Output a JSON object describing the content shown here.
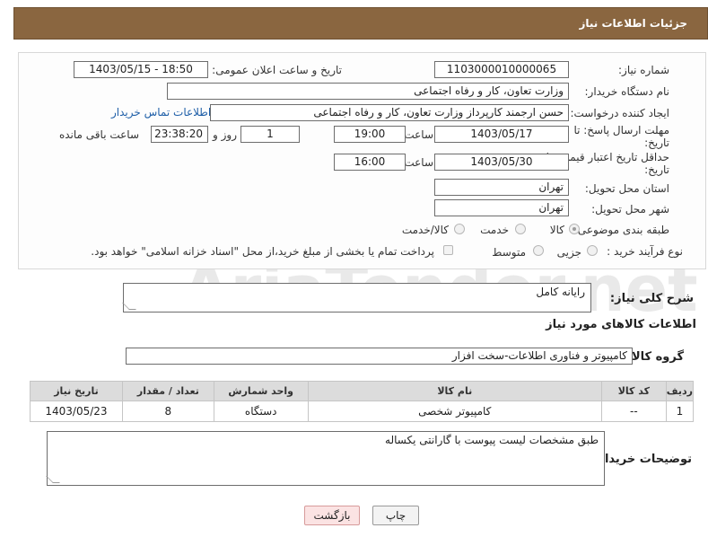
{
  "header": {
    "title": "جزئیات اطلاعات نیاز"
  },
  "form": {
    "need_number_label": "شماره نیاز:",
    "need_number": "1103000010000065",
    "announce_label": "تاریخ و ساعت اعلان عمومی:",
    "announce_value": "1403/05/15 - 18:50",
    "buyer_org_label": "نام دستگاه خریدار:",
    "buyer_org": "وزارت تعاون، کار و رفاه اجتماعی",
    "creator_label": "ایجاد کننده درخواست:",
    "creator": "حسن ارجمند کارپرداز وزارت تعاون، کار و رفاه اجتماعی",
    "buyer_contact_link": "اطلاعات تماس خریدار",
    "deadline_label_line1": "مهلت ارسال پاسخ: تا",
    "deadline_label_line2": "تاریخ:",
    "deadline_date": "1403/05/17",
    "time_label": "ساعت",
    "deadline_time": "19:00",
    "days_value": "1",
    "days_label": "روز و",
    "remaining_time": "23:38:20",
    "remaining_label": "ساعت باقی مانده",
    "price_validity_label_line1": "حداقل تاریخ اعتبار قیمت: تا",
    "price_validity_label_line2": "تاریخ:",
    "price_validity_date": "1403/05/30",
    "price_validity_time_label": "ساعت",
    "price_validity_time": "16:00",
    "province_label": "استان محل تحویل:",
    "province": "تهران",
    "city_label": "شهر محل تحویل:",
    "city": "تهران",
    "category_label": "طبقه بندی موضوعی:",
    "category_options": [
      "کالا",
      "خدمت",
      "کالا/خدمت"
    ],
    "process_label": "نوع فرآیند خرید :",
    "process_options": [
      "جزیی",
      "متوسط"
    ],
    "payment_note": "پرداخت تمام یا بخشی از مبلغ خرید،از محل \"اسناد خزانه اسلامی\" خواهد بود."
  },
  "summary": {
    "label": "شرح کلی نیاز:",
    "value": "رایانه کامل"
  },
  "goods_info_title": "اطلاعات کالاهای مورد نیاز",
  "goods_group": {
    "label": "گروه کالا:",
    "value": "کامپیوتر و فناوری اطلاعات-سخت افزار"
  },
  "table": {
    "headers": [
      "ردیف",
      "کد کالا",
      "نام کالا",
      "واحد شمارش",
      "تعداد / مقدار",
      "تاریخ نیاز"
    ],
    "rows": [
      [
        "1",
        "--",
        "کامپیوتر شخصی",
        "دستگاه",
        "8",
        "1403/05/23"
      ]
    ]
  },
  "buyer_notes": {
    "label": "توضیحات خریدار:",
    "value": "طبق مشخصات لیست پیوست  با گارانتی یکساله"
  },
  "buttons": {
    "print": "چاپ",
    "back": "بازگشت"
  },
  "watermark_text": "AriaTender.net",
  "colors": {
    "header_bg": "#8a6640",
    "table_header_bg": "#dcdcdc",
    "back_button_bg": "#fbe3e3",
    "link": "#1f5fa8"
  }
}
